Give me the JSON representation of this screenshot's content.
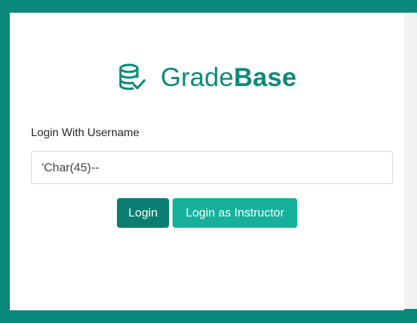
{
  "brand": {
    "icon": "database-check-icon",
    "name_light": "Grade",
    "name_bold": "Base"
  },
  "login": {
    "label": "Login With Username",
    "username_value": "'Char(45)--",
    "login_button": "Login",
    "instructor_button": "Login as Instructor"
  },
  "colors": {
    "brand": "#0b8a7c",
    "login_button": "#0b7d70",
    "instructor_button": "#17b09b",
    "page_frame": "#0b8a7c"
  }
}
